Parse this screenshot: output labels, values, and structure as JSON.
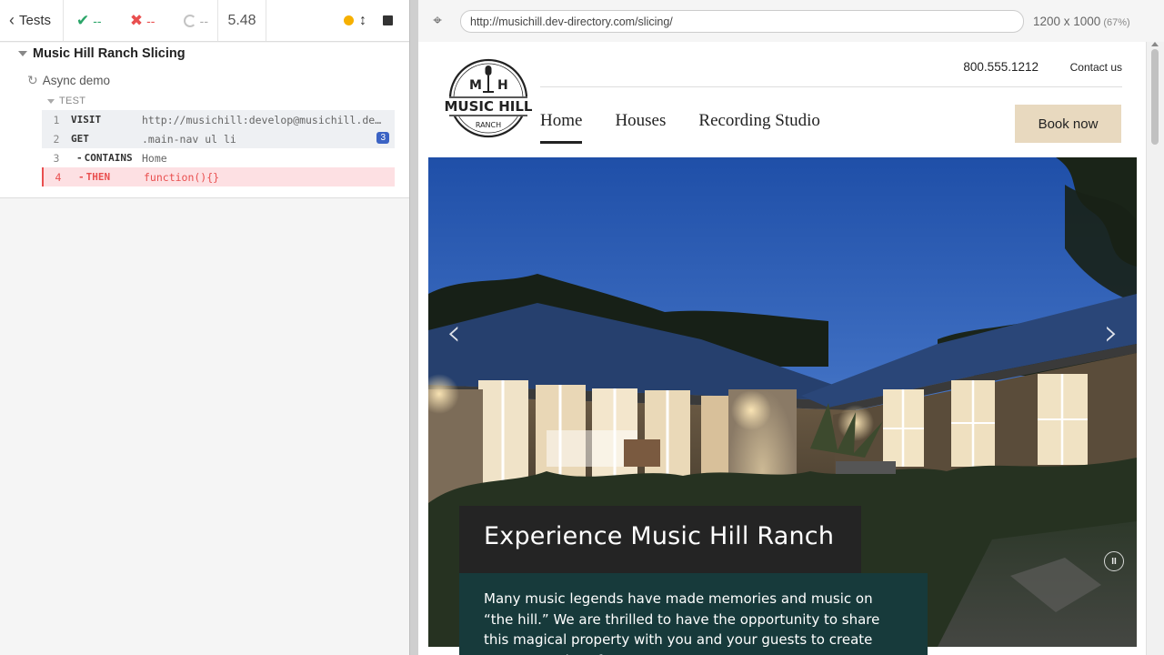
{
  "runner": {
    "tests_label": "Tests",
    "passed": "--",
    "failed": "--",
    "pending": "--",
    "duration": "5.48"
  },
  "command_log": {
    "suite_title": "Music Hill Ranch Slicing",
    "test_title": "Async demo",
    "section_label": "TEST",
    "commands": [
      {
        "num": "1",
        "name": "VISIT",
        "message": "http://musichill:develop@musichill.dev-directory.com/slicing/",
        "state": "passed",
        "child": false
      },
      {
        "num": "2",
        "name": "GET",
        "message": ".main-nav ul li",
        "state": "passed",
        "child": false,
        "badge": "3"
      },
      {
        "num": "3",
        "name": "CONTAINS",
        "message": "Home",
        "state": "passed",
        "child": true
      },
      {
        "num": "4",
        "name": "THEN",
        "message": "function(){}",
        "state": "failed",
        "child": true
      }
    ]
  },
  "aut": {
    "url": "http://musichill.dev-directory.com/slicing/",
    "viewport": "1200 x 1000",
    "scale": "(67%)"
  },
  "site": {
    "logo": {
      "line1_left": "M",
      "line1_right": "H",
      "line2": "MUSIC HILL",
      "line3": "RANCH"
    },
    "phone": "800.555.1212",
    "contact": "Contact us",
    "nav": [
      "Home",
      "Houses",
      "Recording Studio"
    ],
    "book_button": "Book now",
    "hero": {
      "title": "Experience Music Hill Ranch",
      "body": "Many music legends have made memories and music on “the hill.” We are thrilled to have the opportunity to share this magical property with you and your guests to create new memories of your own."
    }
  },
  "colors": {
    "pass": "#2aa568",
    "fail": "#e94f4f",
    "running": "#f6b000",
    "badge": "#3b63c4",
    "book_button": "#e8d9bf",
    "caption_title_bg": "#242424",
    "caption_body_bg": "#173a3b"
  },
  "icons": [
    "chevron-left-icon",
    "check-icon",
    "x-icon",
    "spinner-icon",
    "running-dot-icon",
    "resize-icon",
    "stop-icon",
    "crosshair-icon",
    "arrow-left-icon",
    "arrow-right-icon",
    "pause-icon"
  ]
}
